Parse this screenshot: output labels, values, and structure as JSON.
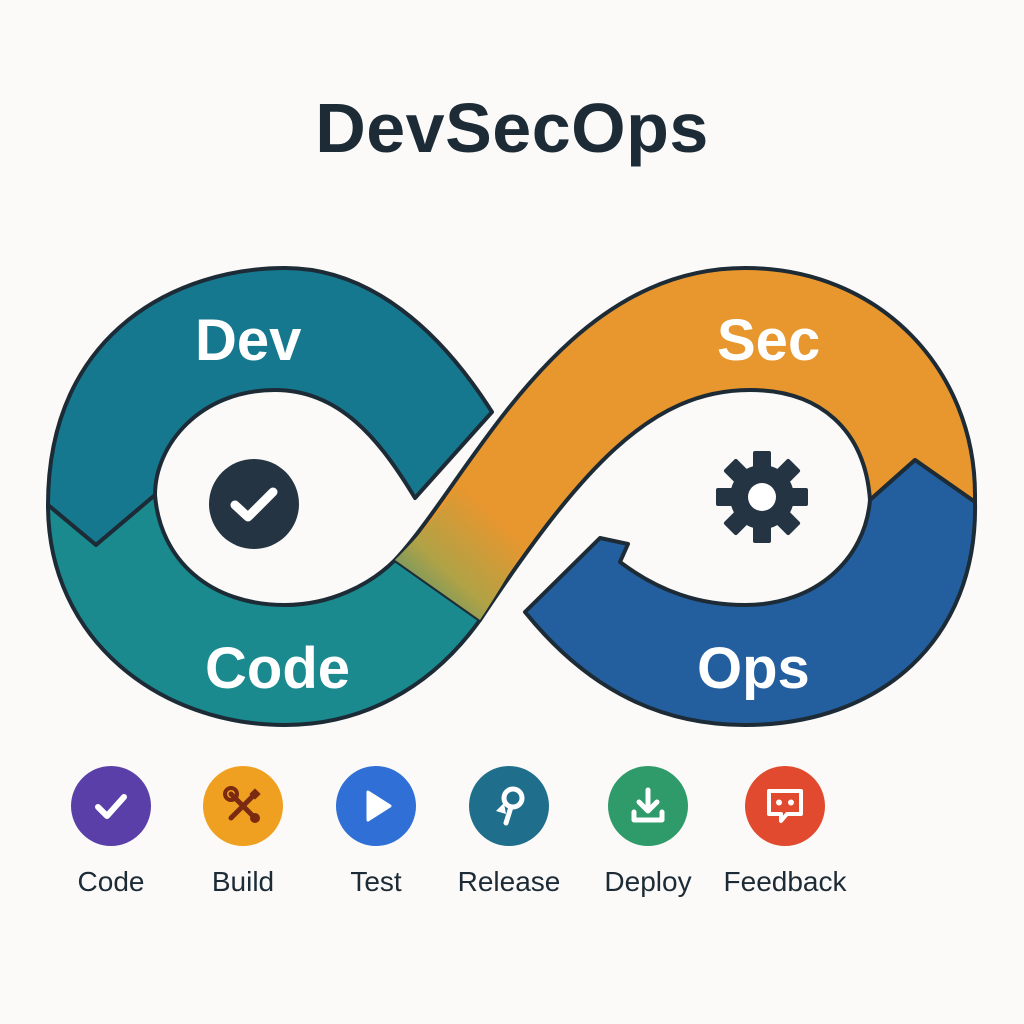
{
  "title": "DevSecOps",
  "loop": {
    "dev_label": "Dev",
    "sec_label": "Sec",
    "code_label": "Code",
    "ops_label": "Ops",
    "left_center_icon": "check-circle-icon",
    "right_center_icon": "gear-icon"
  },
  "colors": {
    "dev_teal": "#16788f",
    "code_teal": "#1a8a8e",
    "sec_orange": "#e8962e",
    "ops_blue": "#235f9e",
    "outline": "#1c2b36",
    "title_text": "#1c2b36"
  },
  "stages": [
    {
      "label": "Code",
      "icon": "check-icon",
      "color": "#5a3fa8"
    },
    {
      "label": "Build",
      "icon": "wrench-screwdriver-icon",
      "color": "#f0a020"
    },
    {
      "label": "Test",
      "icon": "play-icon",
      "color": "#2f6fd6"
    },
    {
      "label": "Release",
      "icon": "key-icon",
      "color": "#1f6e8c"
    },
    {
      "label": "Deploy",
      "icon": "download-icon",
      "color": "#2f9a6a"
    },
    {
      "label": "Feedback",
      "icon": "chat-icon",
      "color": "#e14a2e"
    }
  ]
}
